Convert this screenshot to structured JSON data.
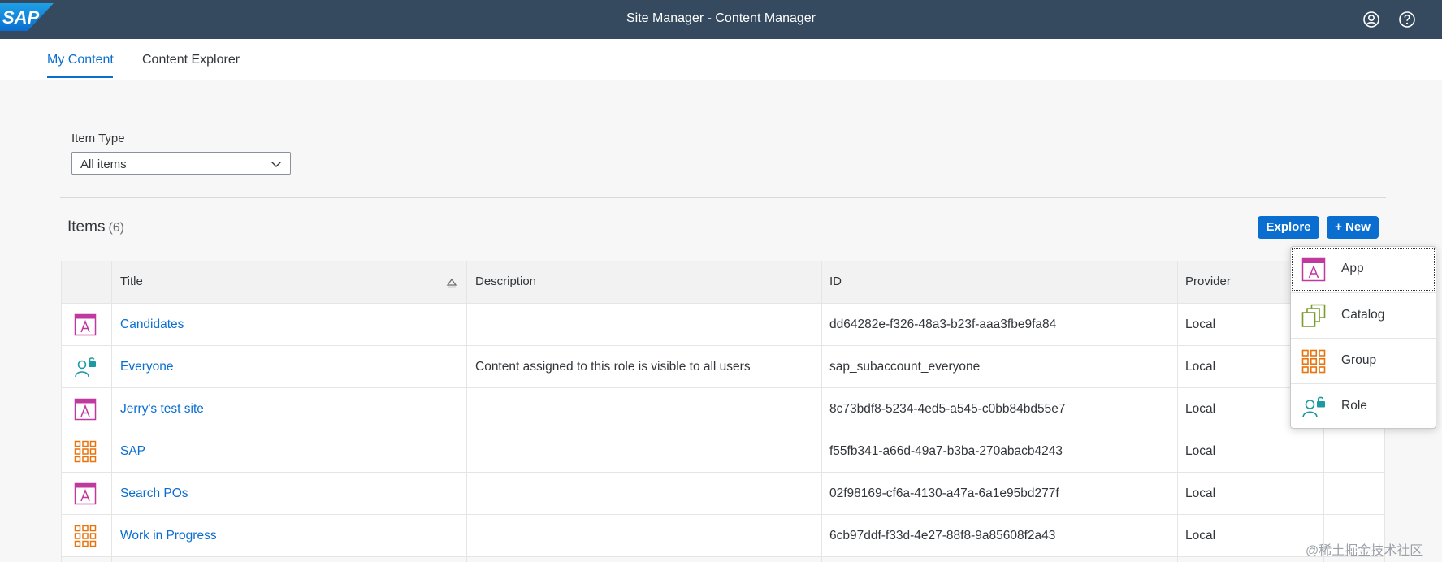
{
  "brand": {
    "logo_text": "SAP",
    "primary_color": "#0a6ed1",
    "shell_color": "#354a5f"
  },
  "shell": {
    "title": "Site Manager - Content Manager",
    "icons": [
      "user-icon",
      "help-icon"
    ]
  },
  "tabs": [
    {
      "label": "My Content",
      "active": true
    },
    {
      "label": "Content Explorer",
      "active": false
    }
  ],
  "filter": {
    "label": "Item Type",
    "value": "All items"
  },
  "items": {
    "title": "Items",
    "count": "(6)"
  },
  "buttons": {
    "explore": "Explore",
    "new": "+ New"
  },
  "table": {
    "columns": [
      "Title",
      "Description",
      "ID",
      "Provider"
    ],
    "rows": [
      {
        "icon": "app-icon",
        "title": "Candidates",
        "description": "",
        "id": "dd64282e-f326-48a3-b23f-aaa3fbe9fa84",
        "provider": "Local"
      },
      {
        "icon": "role-icon",
        "title": "Everyone",
        "description": "Content assigned to this role is visible to all users",
        "id": "sap_subaccount_everyone",
        "provider": "Local"
      },
      {
        "icon": "app-icon",
        "title": "Jerry's test site",
        "description": "",
        "id": "8c73bdf8-5234-4ed5-a545-c0bb84bd55e7",
        "provider": "Local"
      },
      {
        "icon": "group-icon",
        "title": "SAP",
        "description": "",
        "id": "f55fb341-a66d-49a7-b3ba-270abacb4243",
        "provider": "Local"
      },
      {
        "icon": "app-icon",
        "title": "Search POs",
        "description": "",
        "id": "02f98169-cf6a-4130-a47a-6a1e95bd277f",
        "provider": "Local"
      },
      {
        "icon": "group-icon",
        "title": "Work in Progress",
        "description": "",
        "id": "6cb97ddf-f33d-4e27-88f8-9a85608f2a43",
        "provider": "Local"
      }
    ]
  },
  "new_menu": {
    "items": [
      {
        "label": "App",
        "icon": "app-icon"
      },
      {
        "label": "Catalog",
        "icon": "catalog-icon"
      },
      {
        "label": "Group",
        "icon": "group-icon"
      },
      {
        "label": "Role",
        "icon": "role-icon"
      }
    ]
  },
  "watermark": "@稀土掘金技术社区"
}
